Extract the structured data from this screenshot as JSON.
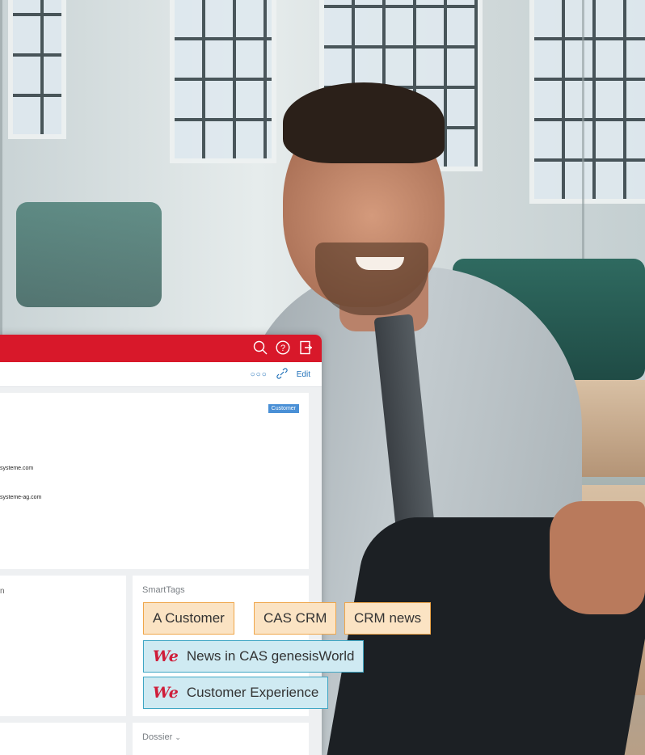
{
  "header": {
    "icons": [
      "search-icon",
      "help-icon",
      "logout-icon"
    ],
    "accent_color": "#d8182a"
  },
  "toolbar": {
    "more_icon": "more-dots-icon",
    "link_icon": "link-icon",
    "edit_label": "Edit"
  },
  "record": {
    "badge": "Customer",
    "email_1": "systeme.com",
    "email_2": "systeme-ag.com"
  },
  "left_panel": {
    "fragment": "n"
  },
  "smarttags": {
    "title": "SmartTags",
    "tags": [
      {
        "label": "A Customer",
        "style": "orange"
      },
      {
        "label": "CAS CRM",
        "style": "orange"
      },
      {
        "label": "CRM news",
        "style": "orange"
      },
      {
        "label": "News in CAS genesisWorld",
        "style": "blue",
        "logo": "We"
      },
      {
        "label": "Customer Experience",
        "style": "blue",
        "logo": "We"
      }
    ]
  },
  "dossier": {
    "title": "Dossier",
    "chevron_icon": "chevron-down-icon"
  }
}
